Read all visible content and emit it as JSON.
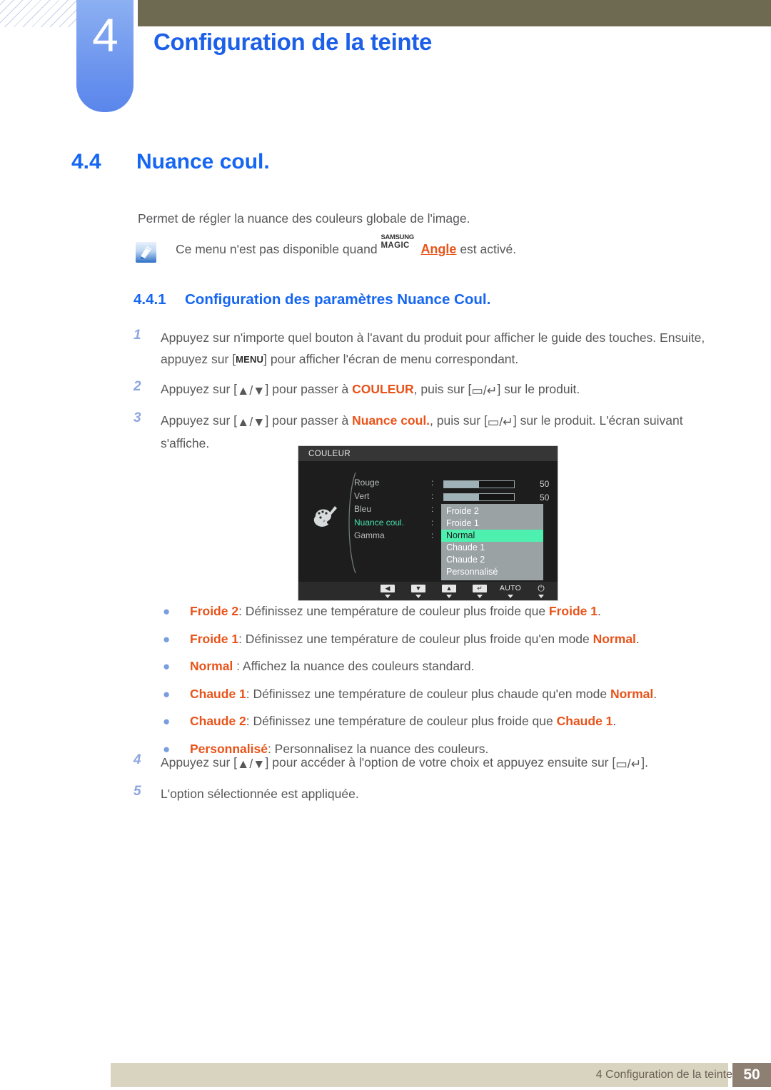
{
  "header": {
    "chapter_number": "4",
    "chapter_title": "Configuration de la teinte"
  },
  "section": {
    "number": "4.4",
    "title": "Nuance coul.",
    "intro": "Permet de régler la nuance des couleurs globale de l'image."
  },
  "note": {
    "icon": "note-pen-icon",
    "text_before": "Ce menu n'est pas disponible quand ",
    "magic_line1": "SAMSUNG",
    "magic_line2": "MAGIC",
    "magic_feature": "Angle",
    "text_after": " est activé."
  },
  "subsection": {
    "number": "4.4.1",
    "title": "Configuration des paramètres Nuance Coul."
  },
  "steps": [
    {
      "index": "1",
      "parts": [
        {
          "t": "Appuyez sur n'importe quel bouton à l'avant du produit pour afficher le guide des touches. Ensuite, appuyez sur ["
        },
        {
          "t": "MENU",
          "style": "key"
        },
        {
          "t": "] pour afficher l'écran de menu correspondant."
        }
      ]
    },
    {
      "index": "2",
      "parts": [
        {
          "t": "Appuyez sur ["
        },
        {
          "t": "▲/▼",
          "style": "glyph"
        },
        {
          "t": "] pour passer à "
        },
        {
          "t": "COULEUR",
          "style": "highlight"
        },
        {
          "t": ", puis sur ["
        },
        {
          "t": "▭/↵",
          "style": "glyph"
        },
        {
          "t": "] sur le produit."
        }
      ]
    },
    {
      "index": "3",
      "parts": [
        {
          "t": "Appuyez sur ["
        },
        {
          "t": "▲/▼",
          "style": "glyph"
        },
        {
          "t": "] pour passer à "
        },
        {
          "t": "Nuance coul.",
          "style": "highlight"
        },
        {
          "t": ", puis sur ["
        },
        {
          "t": "▭/↵",
          "style": "glyph"
        },
        {
          "t": "] sur le produit. L'écran suivant s'affiche."
        }
      ]
    }
  ],
  "osd": {
    "title": "COULEUR",
    "icon": "color-palette-icon",
    "menu_items": [
      {
        "label": "Rouge",
        "active": false
      },
      {
        "label": "Vert",
        "active": false
      },
      {
        "label": "Bleu",
        "active": false
      },
      {
        "label": "Nuance coul.",
        "active": true
      },
      {
        "label": "Gamma",
        "active": false
      }
    ],
    "colon": ":",
    "sliders": [
      {
        "name": "Rouge",
        "value": "50",
        "fill_percent": 50
      },
      {
        "name": "Vert",
        "value": "50",
        "fill_percent": 50
      }
    ],
    "dropdown": {
      "options": [
        "Froide 2",
        "Froide 1",
        "Normal",
        "Chaude 1",
        "Chaude 2",
        "Personnalisé"
      ],
      "selected": "Normal",
      "selected_color": "#4ef0b0",
      "background_color": "#9aa2a4"
    },
    "buttons": [
      {
        "name": "back-button",
        "glyph": "◀",
        "type": "glyph"
      },
      {
        "name": "down-button",
        "glyph": "▼",
        "type": "glyph"
      },
      {
        "name": "up-button",
        "glyph": "▲",
        "type": "glyph"
      },
      {
        "name": "enter-button",
        "glyph": "↵",
        "type": "glyph"
      },
      {
        "name": "auto-button",
        "glyph": "AUTO",
        "type": "text"
      },
      {
        "name": "power-button",
        "glyph": "⏻",
        "type": "power"
      }
    ]
  },
  "bullets": [
    {
      "marker": "●",
      "parts": [
        {
          "t": "Froide 2",
          "style": "highlight"
        },
        {
          "t": ": Définissez une température de couleur plus froide que "
        },
        {
          "t": "Froide 1",
          "style": "highlight"
        },
        {
          "t": "."
        }
      ]
    },
    {
      "marker": "●",
      "parts": [
        {
          "t": "Froide 1",
          "style": "highlight"
        },
        {
          "t": ": Définissez une température de couleur plus froide qu'en mode "
        },
        {
          "t": "Normal",
          "style": "highlight"
        },
        {
          "t": "."
        }
      ]
    },
    {
      "marker": "●",
      "parts": [
        {
          "t": "Normal",
          "style": "highlight"
        },
        {
          "t": " : Affichez la nuance des couleurs standard."
        }
      ]
    },
    {
      "marker": "●",
      "parts": [
        {
          "t": "Chaude 1",
          "style": "highlight"
        },
        {
          "t": ": Définissez une température de couleur plus chaude qu'en mode "
        },
        {
          "t": "Normal",
          "style": "highlight"
        },
        {
          "t": "."
        }
      ]
    },
    {
      "marker": "●",
      "parts": [
        {
          "t": "Chaude 2",
          "style": "highlight"
        },
        {
          "t": ": Définissez une température de couleur plus froide que "
        },
        {
          "t": "Chaude 1",
          "style": "highlight"
        },
        {
          "t": "."
        }
      ]
    },
    {
      "marker": "●",
      "parts": [
        {
          "t": "Personnalisé",
          "style": "highlight"
        },
        {
          "t": ": Personnalisez la nuance des couleurs."
        }
      ]
    }
  ],
  "steps_after": [
    {
      "index": "4",
      "parts": [
        {
          "t": "Appuyez sur ["
        },
        {
          "t": "▲/▼",
          "style": "glyph"
        },
        {
          "t": "] pour accéder à l'option de votre choix et appuyez ensuite sur ["
        },
        {
          "t": "▭/↵",
          "style": "glyph"
        },
        {
          "t": "]."
        }
      ]
    },
    {
      "index": "5",
      "parts": [
        {
          "t": "L'option sélectionnée est appliquée."
        }
      ]
    }
  ],
  "footer": {
    "text": "4 Configuration de la teinte",
    "page_number": "50"
  },
  "colors": {
    "heading_blue": "#1566f2",
    "highlight_orange": "#e8531a",
    "body_gray": "#58585a",
    "tab_blue": "#6f97ee",
    "olive": "#6e6a52",
    "footer_beige": "#d9d4bf",
    "footer_brown": "#8d7f72"
  }
}
